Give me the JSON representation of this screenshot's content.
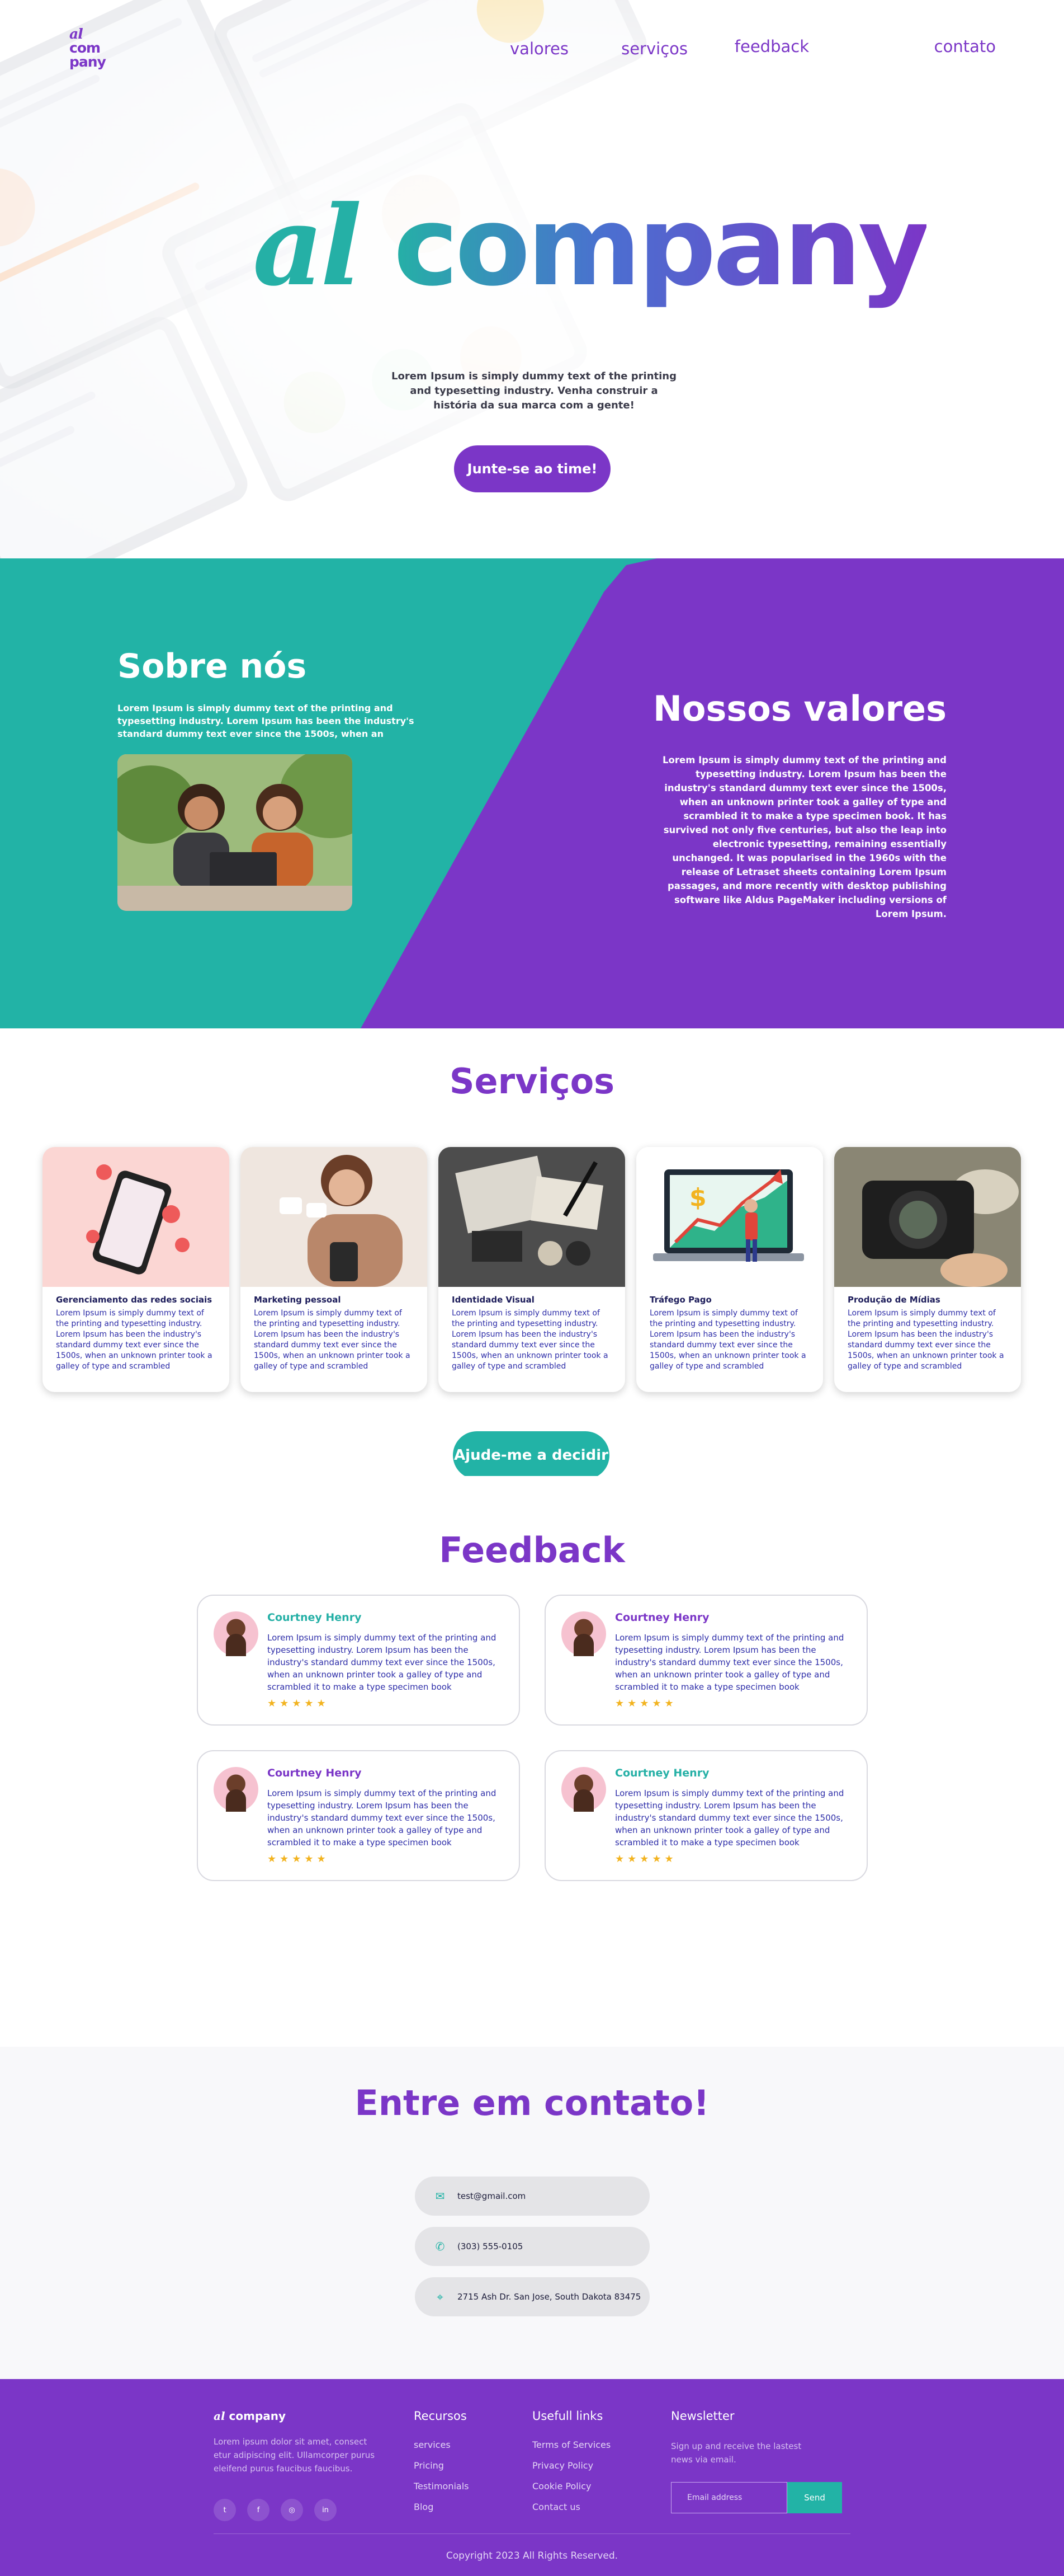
{
  "header": {
    "logo_line1": "al",
    "logo_line2": "com",
    "logo_line3": "pany",
    "nav": [
      "valores",
      "serviços",
      "feedback",
      "contato"
    ]
  },
  "hero": {
    "title_al": "al",
    "title_rest": "company",
    "subtitle": "Lorem Ipsum is simply dummy text of the printing and typesetting industry. Venha construir a história da sua marca com a gente!",
    "cta": "Junte-se ao time!"
  },
  "about": {
    "title": "Sobre nós",
    "text": "Lorem Ipsum is simply dummy text of the printing and typesetting industry. Lorem Ipsum has been the industry's standard dummy text ever since the 1500s, when an"
  },
  "values": {
    "title": "Nossos valores",
    "text": "Lorem Ipsum is simply dummy text of the printing and typesetting industry. Lorem Ipsum has been the industry's standard dummy text ever since the 1500s, when an unknown printer took a galley of type and scrambled it to make a type specimen book. It has survived not only five centuries, but also the leap into electronic typesetting, remaining essentially unchanged. It was popularised in the 1960s with the release of Letraset sheets containing Lorem Ipsum passages, and more recently with desktop publishing software like Aldus PageMaker including versions of Lorem Ipsum."
  },
  "services": {
    "title": "Serviços",
    "cards": [
      {
        "title": "Gerenciamento das redes sociais",
        "text": "Lorem Ipsum is simply dummy text of the printing and typesetting industry. Lorem Ipsum has been the industry's standard dummy text ever since the 1500s, when an unknown printer took a galley of type and scrambled"
      },
      {
        "title": "Marketing pessoal",
        "text": "Lorem Ipsum is simply dummy text of the printing and typesetting industry. Lorem Ipsum has been the industry's standard dummy text ever since the 1500s, when an unknown printer took a galley of type and scrambled"
      },
      {
        "title": "Identidade Visual",
        "text": "Lorem Ipsum is simply dummy text of the printing and typesetting industry. Lorem Ipsum has been the industry's standard dummy text ever since the 1500s, when an unknown printer took a galley of type and scrambled"
      },
      {
        "title": "Tráfego Pago",
        "text": "Lorem Ipsum is simply dummy text of the printing and typesetting industry. Lorem Ipsum has been the industry's standard dummy text ever since the 1500s, when an unknown printer took a galley of type and scrambled"
      },
      {
        "title": "Produção de Mídias",
        "text": "Lorem Ipsum is simply dummy text of the printing and typesetting industry. Lorem Ipsum has been the industry's standard dummy text ever since the 1500s, when an unknown printer took a galley of type and scrambled"
      }
    ],
    "cta": "Ajude-me a decidir"
  },
  "feedback": {
    "title": "Feedback",
    "reviews": [
      {
        "name": "Courtney Henry",
        "text": "Lorem Ipsum is simply dummy text of the printing and typesetting industry. Lorem Ipsum has been the industry's standard dummy text ever since the 1500s, when an unknown printer took a galley of type and scrambled it to make a type specimen book",
        "stars": "★★★★★",
        "rating": 5,
        "name_color": "#25b0a6"
      },
      {
        "name": "Courtney Henry",
        "text": "Lorem Ipsum is simply dummy text of the printing and typesetting industry. Lorem Ipsum has been the industry's standard dummy text ever since the 1500s, when an unknown printer took a galley of type and scrambled it to make a type specimen book",
        "stars": "★★★★★",
        "rating": 5,
        "name_color": "#7b36c7"
      },
      {
        "name": "Courtney Henry",
        "text": "Lorem Ipsum is simply dummy text of the printing and typesetting industry. Lorem Ipsum has been the industry's standard dummy text ever since the 1500s, when an unknown printer took a galley of type and scrambled it to make a type specimen book",
        "stars": "★★★★★",
        "rating": 5,
        "name_color": "#7b36c7"
      },
      {
        "name": "Courtney Henry",
        "text": "Lorem Ipsum is simply dummy text of the printing and typesetting industry. Lorem Ipsum has been the industry's standard dummy text ever since the 1500s, when an unknown printer took a galley of type and scrambled it to make a type specimen book",
        "stars": "★★★★★",
        "rating": 5,
        "name_color": "#25b0a6"
      }
    ]
  },
  "contact": {
    "title": "Entre em contato!",
    "email": "test@gmail.com",
    "phone": "(303) 555-0105",
    "address": "2715 Ash Dr. San Jose, South Dakota 83475"
  },
  "footer": {
    "logo_al": "al",
    "logo_rest": "company",
    "description": "Lorem ipsum dolor sit amet, consect etur adipiscing elit. Ullamcorper purus eleifend purus faucibus faucibus.",
    "socials": [
      "twitter-icon",
      "facebook-icon",
      "instagram-icon",
      "linkedin-icon"
    ],
    "resources_title": "Recursos",
    "resources": [
      "services",
      "Pricing",
      "Testimonials",
      "Blog"
    ],
    "useful_title": "Usefull links",
    "useful": [
      "Terms of Services",
      "Privacy Policy",
      "Cookie Policy",
      "Contact us"
    ],
    "newsletter_title": "Newsletter",
    "newsletter_text": "Sign up and receive the lastest news via email.",
    "email_placeholder": "Email address",
    "send_label": "Send",
    "copyright": "Copyright 2023  All Rights Reserved."
  },
  "colors": {
    "purple": "#7b36c7",
    "teal": "#22b3a6",
    "star": "#f2b31f"
  }
}
